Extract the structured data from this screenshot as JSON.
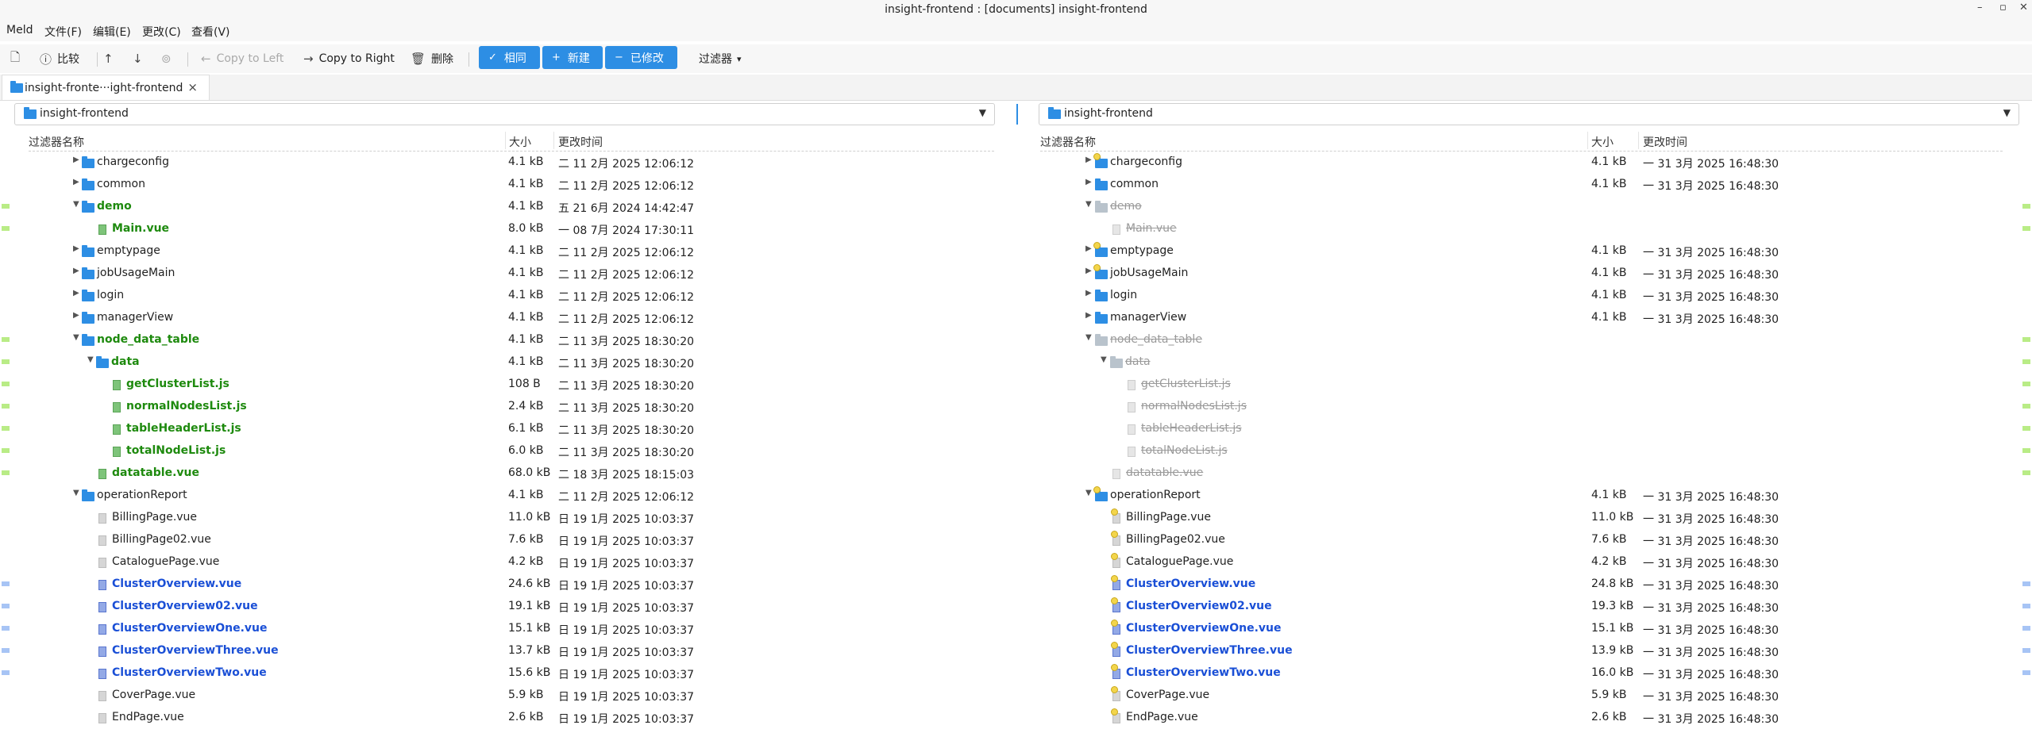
{
  "window": {
    "title": "insight-frontend : [documents] insight-frontend",
    "controls": [
      "–",
      "▫",
      "✕"
    ]
  },
  "menubar": [
    "Meld",
    "文件(F)",
    "编辑(E)",
    "更改(C)",
    "查看(V)"
  ],
  "toolbar": {
    "compare_label": "比较",
    "copy_left_label": "Copy to Left",
    "copy_right_label": "Copy to Right",
    "delete_label": "删除",
    "same_label": "相同",
    "new_label": "新建",
    "modified_label": "已修改",
    "filter_label": "过滤器",
    "accent_color": "#2d8ee4"
  },
  "tab": {
    "label": "insight-fronte···ight-frontend",
    "close": "×"
  },
  "left": {
    "location": "insight-frontend",
    "headers": {
      "name": "过滤器名称",
      "size": "大小",
      "time": "更改时间"
    }
  },
  "right": {
    "location": "insight-frontend",
    "headers": {
      "name": "过滤器名称",
      "size": "大小",
      "time": "更改时间"
    }
  },
  "rows": [
    {
      "depth": 0,
      "type": "folder",
      "exp": "right",
      "l": {
        "name": "chargeconfig",
        "size": "4.1 kB",
        "time": "二 11 2月 2025 12:06:12",
        "st": "norm"
      },
      "r": {
        "name": "chargeconfig",
        "size": "4.1 kB",
        "time": "一 31 3月 2025 16:48:30",
        "st": "norm",
        "badge": true
      }
    },
    {
      "depth": 0,
      "type": "folder",
      "exp": "right",
      "l": {
        "name": "common",
        "size": "4.1 kB",
        "time": "二 11 2月 2025 12:06:12",
        "st": "norm"
      },
      "r": {
        "name": "common",
        "size": "4.1 kB",
        "time": "一 31 3月 2025 16:48:30",
        "st": "norm",
        "badge": false
      }
    },
    {
      "depth": 0,
      "type": "folder",
      "exp": "down",
      "l": {
        "name": "demo",
        "size": "4.1 kB",
        "time": "五 21 6月 2024 14:42:47",
        "st": "green"
      },
      "r": {
        "name": "demo",
        "size": "",
        "time": "",
        "st": "gray",
        "badge": false
      }
    },
    {
      "depth": 1,
      "type": "file",
      "exp": "none",
      "l": {
        "name": "Main.vue",
        "size": "8.0 kB",
        "time": "一 08 7月 2024 17:30:11",
        "st": "green"
      },
      "r": {
        "name": "Main.vue",
        "size": "",
        "time": "",
        "st": "gray",
        "badge": false
      }
    },
    {
      "depth": 0,
      "type": "folder",
      "exp": "right",
      "l": {
        "name": "emptypage",
        "size": "4.1 kB",
        "time": "二 11 2月 2025 12:06:12",
        "st": "norm"
      },
      "r": {
        "name": "emptypage",
        "size": "4.1 kB",
        "time": "一 31 3月 2025 16:48:30",
        "st": "norm",
        "badge": true
      }
    },
    {
      "depth": 0,
      "type": "folder",
      "exp": "right",
      "l": {
        "name": "jobUsageMain",
        "size": "4.1 kB",
        "time": "二 11 2月 2025 12:06:12",
        "st": "norm"
      },
      "r": {
        "name": "jobUsageMain",
        "size": "4.1 kB",
        "time": "一 31 3月 2025 16:48:30",
        "st": "norm",
        "badge": true
      }
    },
    {
      "depth": 0,
      "type": "folder",
      "exp": "right",
      "l": {
        "name": "login",
        "size": "4.1 kB",
        "time": "二 11 2月 2025 12:06:12",
        "st": "norm"
      },
      "r": {
        "name": "login",
        "size": "4.1 kB",
        "time": "一 31 3月 2025 16:48:30",
        "st": "norm",
        "badge": false
      }
    },
    {
      "depth": 0,
      "type": "folder",
      "exp": "right",
      "l": {
        "name": "managerView",
        "size": "4.1 kB",
        "time": "二 11 2月 2025 12:06:12",
        "st": "norm"
      },
      "r": {
        "name": "managerView",
        "size": "4.1 kB",
        "time": "一 31 3月 2025 16:48:30",
        "st": "norm",
        "badge": false
      }
    },
    {
      "depth": 0,
      "type": "folder",
      "exp": "down",
      "l": {
        "name": "node_data_table",
        "size": "4.1 kB",
        "time": "二 11 3月 2025 18:30:20",
        "st": "green"
      },
      "r": {
        "name": "node_data_table",
        "size": "",
        "time": "",
        "st": "gray",
        "badge": false
      }
    },
    {
      "depth": 1,
      "type": "folder",
      "exp": "down",
      "l": {
        "name": "data",
        "size": "4.1 kB",
        "time": "二 11 3月 2025 18:30:20",
        "st": "green"
      },
      "r": {
        "name": "data",
        "size": "",
        "time": "",
        "st": "gray",
        "badge": false
      }
    },
    {
      "depth": 2,
      "type": "file",
      "exp": "none",
      "l": {
        "name": "getClusterList.js",
        "size": "108 B",
        "time": "二 11 3月 2025 18:30:20",
        "st": "green"
      },
      "r": {
        "name": "getClusterList.js",
        "size": "",
        "time": "",
        "st": "gray",
        "badge": false
      }
    },
    {
      "depth": 2,
      "type": "file",
      "exp": "none",
      "l": {
        "name": "normalNodesList.js",
        "size": "2.4 kB",
        "time": "二 11 3月 2025 18:30:20",
        "st": "green"
      },
      "r": {
        "name": "normalNodesList.js",
        "size": "",
        "time": "",
        "st": "gray",
        "badge": false
      }
    },
    {
      "depth": 2,
      "type": "file",
      "exp": "none",
      "l": {
        "name": "tableHeaderList.js",
        "size": "6.1 kB",
        "time": "二 11 3月 2025 18:30:20",
        "st": "green"
      },
      "r": {
        "name": "tableHeaderList.js",
        "size": "",
        "time": "",
        "st": "gray",
        "badge": false
      }
    },
    {
      "depth": 2,
      "type": "file",
      "exp": "none",
      "l": {
        "name": "totalNodeList.js",
        "size": "6.0 kB",
        "time": "二 11 3月 2025 18:30:20",
        "st": "green"
      },
      "r": {
        "name": "totalNodeList.js",
        "size": "",
        "time": "",
        "st": "gray",
        "badge": false
      }
    },
    {
      "depth": 1,
      "type": "file",
      "exp": "none",
      "l": {
        "name": "datatable.vue",
        "size": "68.0 kB",
        "time": "二 18 3月 2025 18:15:03",
        "st": "green"
      },
      "r": {
        "name": "datatable.vue",
        "size": "",
        "time": "",
        "st": "gray",
        "badge": false
      }
    },
    {
      "depth": 0,
      "type": "folder",
      "exp": "down",
      "l": {
        "name": "operationReport",
        "size": "4.1 kB",
        "time": "二 11 2月 2025 12:06:12",
        "st": "norm"
      },
      "r": {
        "name": "operationReport",
        "size": "4.1 kB",
        "time": "一 31 3月 2025 16:48:30",
        "st": "norm",
        "badge": true
      }
    },
    {
      "depth": 1,
      "type": "file",
      "exp": "none",
      "l": {
        "name": "BillingPage.vue",
        "size": "11.0 kB",
        "time": "日 19 1月 2025 10:03:37",
        "st": "norm"
      },
      "r": {
        "name": "BillingPage.vue",
        "size": "11.0 kB",
        "time": "一 31 3月 2025 16:48:30",
        "st": "norm",
        "badge": true
      }
    },
    {
      "depth": 1,
      "type": "file",
      "exp": "none",
      "l": {
        "name": "BillingPage02.vue",
        "size": "7.6 kB",
        "time": "日 19 1月 2025 10:03:37",
        "st": "norm"
      },
      "r": {
        "name": "BillingPage02.vue",
        "size": "7.6 kB",
        "time": "一 31 3月 2025 16:48:30",
        "st": "norm",
        "badge": true
      }
    },
    {
      "depth": 1,
      "type": "file",
      "exp": "none",
      "l": {
        "name": "CataloguePage.vue",
        "size": "4.2 kB",
        "time": "日 19 1月 2025 10:03:37",
        "st": "norm"
      },
      "r": {
        "name": "CataloguePage.vue",
        "size": "4.2 kB",
        "time": "一 31 3月 2025 16:48:30",
        "st": "norm",
        "badge": true
      }
    },
    {
      "depth": 1,
      "type": "file",
      "exp": "none",
      "l": {
        "name": "ClusterOverview.vue",
        "size": "24.6 kB",
        "time": "日 19 1月 2025 10:03:37",
        "st": "blue"
      },
      "r": {
        "name": "ClusterOverview.vue",
        "size": "24.8 kB",
        "time": "一 31 3月 2025 16:48:30",
        "st": "blue",
        "badge": true
      }
    },
    {
      "depth": 1,
      "type": "file",
      "exp": "none",
      "l": {
        "name": "ClusterOverview02.vue",
        "size": "19.1 kB",
        "time": "日 19 1月 2025 10:03:37",
        "st": "blue"
      },
      "r": {
        "name": "ClusterOverview02.vue",
        "size": "19.3 kB",
        "time": "一 31 3月 2025 16:48:30",
        "st": "blue",
        "badge": true
      }
    },
    {
      "depth": 1,
      "type": "file",
      "exp": "none",
      "l": {
        "name": "ClusterOverviewOne.vue",
        "size": "15.1 kB",
        "time": "日 19 1月 2025 10:03:37",
        "st": "blue"
      },
      "r": {
        "name": "ClusterOverviewOne.vue",
        "size": "15.1 kB",
        "time": "一 31 3月 2025 16:48:30",
        "st": "blue",
        "badge": true
      }
    },
    {
      "depth": 1,
      "type": "file",
      "exp": "none",
      "l": {
        "name": "ClusterOverviewThree.vue",
        "size": "13.7 kB",
        "time": "日 19 1月 2025 10:03:37",
        "st": "blue"
      },
      "r": {
        "name": "ClusterOverviewThree.vue",
        "size": "13.9 kB",
        "time": "一 31 3月 2025 16:48:30",
        "st": "blue",
        "badge": true
      }
    },
    {
      "depth": 1,
      "type": "file",
      "exp": "none",
      "l": {
        "name": "ClusterOverviewTwo.vue",
        "size": "15.6 kB",
        "time": "日 19 1月 2025 10:03:37",
        "st": "blue"
      },
      "r": {
        "name": "ClusterOverviewTwo.vue",
        "size": "16.0 kB",
        "time": "一 31 3月 2025 16:48:30",
        "st": "blue",
        "badge": true
      }
    },
    {
      "depth": 1,
      "type": "file",
      "exp": "none",
      "l": {
        "name": "CoverPage.vue",
        "size": "5.9 kB",
        "time": "日 19 1月 2025 10:03:37",
        "st": "norm"
      },
      "r": {
        "name": "CoverPage.vue",
        "size": "5.9 kB",
        "time": "一 31 3月 2025 16:48:30",
        "st": "norm",
        "badge": true
      }
    },
    {
      "depth": 1,
      "type": "file",
      "exp": "none",
      "l": {
        "name": "EndPage.vue",
        "size": "2.6 kB",
        "time": "日 19 1月 2025 10:03:37",
        "st": "norm"
      },
      "r": {
        "name": "EndPage.vue",
        "size": "2.6 kB",
        "time": "一 31 3月 2025 16:48:30",
        "st": "norm",
        "badge": true
      }
    }
  ],
  "colors": {
    "added": "#1e8a0e",
    "modified": "#1a4fd6",
    "missing": "#9a9a9a",
    "gutter_added": "#b9ec86",
    "gutter_modified": "#a7c4f5"
  }
}
